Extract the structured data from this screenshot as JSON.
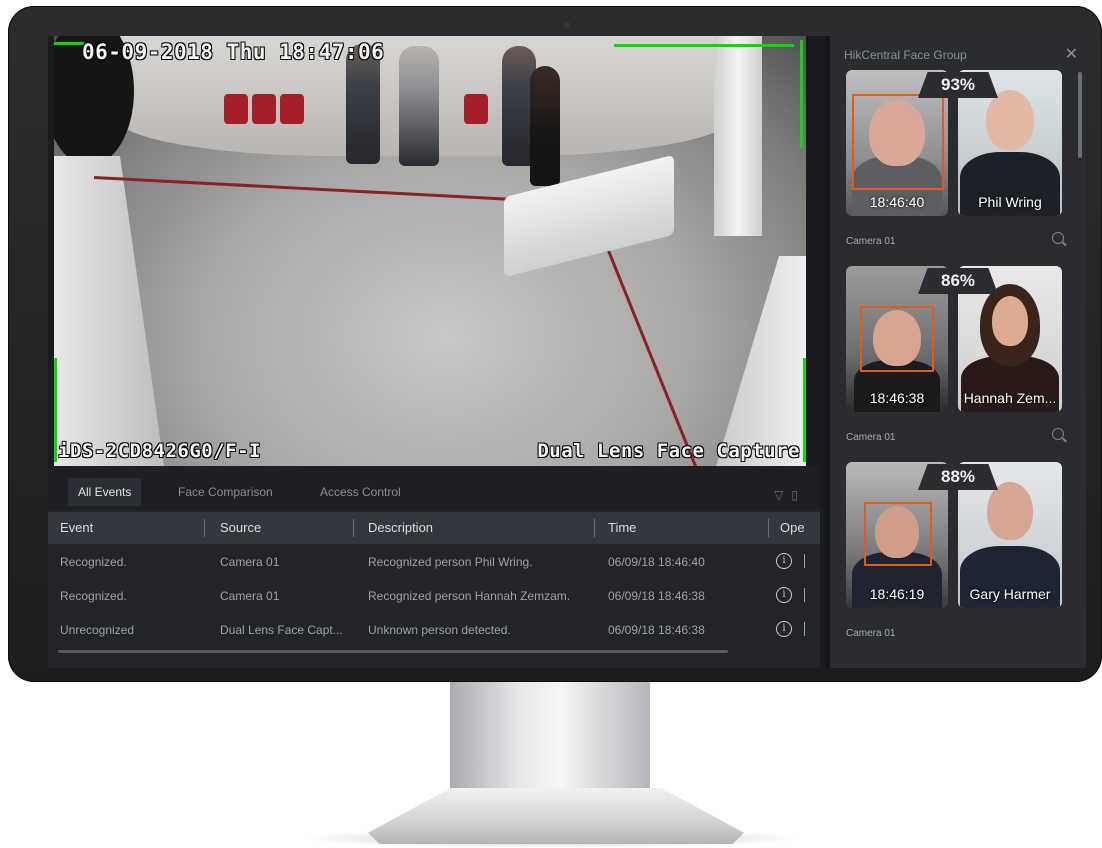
{
  "video": {
    "timestamp": "06-09-2018 Thu 18:47:06",
    "camera_model": "iDS-2CD8426G0/F-I",
    "camera_label": "Dual Lens Face Capture"
  },
  "events_panel": {
    "tabs": [
      {
        "label": "All Events",
        "active": true
      },
      {
        "label": "Face Comparison",
        "active": false
      },
      {
        "label": "Access Control",
        "active": false
      }
    ],
    "tool_icons": [
      "filter-icon",
      "trash-icon"
    ],
    "columns": [
      "Event",
      "Source",
      "Description",
      "Time",
      "Ope"
    ],
    "rows": [
      {
        "event": "Recognized.",
        "source": "Camera 01",
        "description": "Recognized person Phil Wring.",
        "time": "06/09/18 18:46:40"
      },
      {
        "event": "Recognized.",
        "source": "Camera 01",
        "description": "Recognized person Hannah Zemzam.",
        "time": "06/09/18 18:46:38"
      },
      {
        "event": "Unrecognized",
        "source": "Dual Lens Face Capt...",
        "description": "Unknown person detected.",
        "time": "06/09/18 18:46:38"
      }
    ],
    "row_action_icon": "info-icon"
  },
  "face_group": {
    "title": "HikCentral Face Group",
    "close_icon": "close-icon",
    "matches": [
      {
        "percent": "93%",
        "capture_time": "18:46:40",
        "name": "Phil Wring",
        "camera": "Camera 01"
      },
      {
        "percent": "86%",
        "capture_time": "18:46:38",
        "name": "Hannah Zem...",
        "camera": "Camera 01"
      },
      {
        "percent": "88%",
        "capture_time": "18:46:19",
        "name": "Gary Harmer",
        "camera": "Camera 01"
      }
    ]
  },
  "colors": {
    "detection_box": "#12d40f",
    "face_box": "#e05b1e",
    "panel_bg": "#22242a",
    "header_bg": "#34373d"
  }
}
